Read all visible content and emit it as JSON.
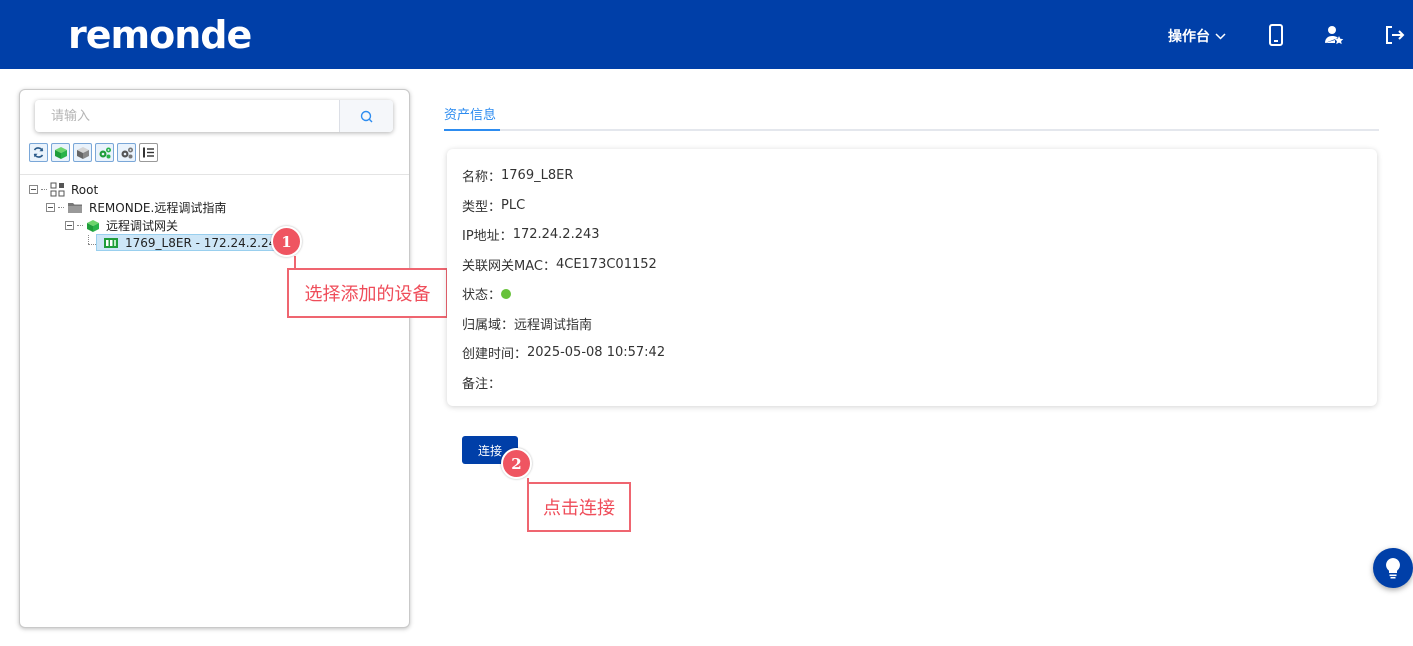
{
  "header": {
    "logo_text": "remonde",
    "menu_label": "操作台",
    "icons": [
      "mobile-icon",
      "user-star-icon",
      "logout-icon"
    ]
  },
  "sidebar": {
    "search_placeholder": "请输入",
    "toolbar": [
      "refresh-icon",
      "cube-green-icon",
      "cube-gray-icon",
      "gears-green-icon",
      "gears-gray-icon",
      "list-icon"
    ],
    "tree": {
      "root": "Root",
      "domain": "REMONDE.远程调试指南",
      "gateway": "远程调试网关",
      "device": "1769_L8ER - 172.24.2.243"
    }
  },
  "annotations": {
    "step1_num": "1",
    "step1_text": "选择添加的设备",
    "step2_num": "2",
    "step2_text": "点击连接"
  },
  "tabs": {
    "asset_info": "资产信息"
  },
  "info": {
    "name_label": "名称：",
    "name_value": "1769_L8ER",
    "type_label": "类型：",
    "type_value": "PLC",
    "ip_label": "IP地址：",
    "ip_value": "172.24.2.243",
    "mac_label": "关联网关MAC：",
    "mac_value": "4CE173C01152",
    "status_label": "状态：",
    "status_color": "#67c23a",
    "domain_label": "归属域：",
    "domain_value": "远程调试指南",
    "created_label": "创建时间：",
    "created_value": "2025-05-08 10:57:42",
    "remark_label": "备注：",
    "remark_value": ""
  },
  "actions": {
    "connect_label": "连接"
  },
  "colors": {
    "brand": "#003fa8",
    "accent": "#2d8cf0",
    "callout": "#ef5561"
  }
}
